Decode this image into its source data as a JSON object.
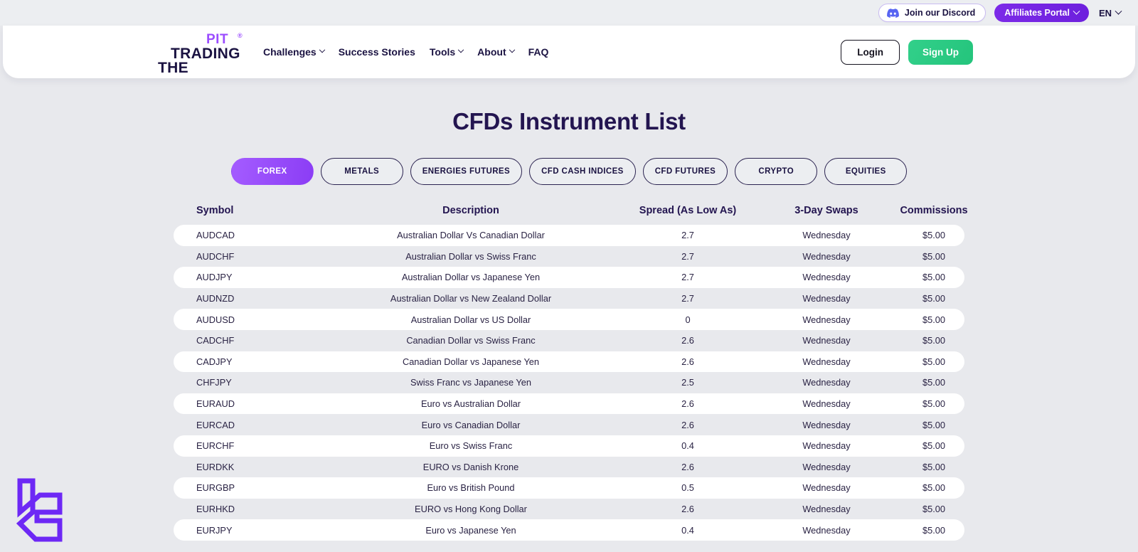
{
  "topbar": {
    "discord_label": "Join our Discord",
    "discord_icon": "discord-icon",
    "affiliates_label": "Affiliates Portal",
    "lang_label": "EN"
  },
  "header": {
    "logo": {
      "the": "THE",
      "trading": "TRADING",
      "pit": "PIT",
      "tm": "®"
    },
    "nav": [
      {
        "label": "Challenges",
        "has_caret": true
      },
      {
        "label": "Success Stories",
        "has_caret": false
      },
      {
        "label": "Tools",
        "has_caret": true
      },
      {
        "label": "About",
        "has_caret": true
      },
      {
        "label": "FAQ",
        "has_caret": false
      }
    ],
    "login_label": "Login",
    "signup_label": "Sign Up"
  },
  "main": {
    "title": "CFDs Instrument List",
    "tabs": [
      {
        "label": "FOREX",
        "active": true
      },
      {
        "label": "METALS",
        "active": false
      },
      {
        "label": "ENERGIES FUTURES",
        "active": false
      },
      {
        "label": "CFD CASH INDICES",
        "active": false
      },
      {
        "label": "CFD FUTURES",
        "active": false
      },
      {
        "label": "CRYPTO",
        "active": false
      },
      {
        "label": "EQUITIES",
        "active": false
      }
    ],
    "table": {
      "columns": [
        "Symbol",
        "Description",
        "Spread (As Low As)",
        "3-Day Swaps",
        "Commissions"
      ],
      "rows": [
        [
          "AUDCAD",
          "Australian Dollar Vs Canadian Dollar",
          "2.7",
          "Wednesday",
          "$5.00"
        ],
        [
          "AUDCHF",
          "Australian Dollar vs Swiss Franc",
          "2.7",
          "Wednesday",
          "$5.00"
        ],
        [
          "AUDJPY",
          "Australian Dollar vs Japanese Yen",
          "2.7",
          "Wednesday",
          "$5.00"
        ],
        [
          "AUDNZD",
          "Australian Dollar vs New Zealand Dollar",
          "2.7",
          "Wednesday",
          "$5.00"
        ],
        [
          "AUDUSD",
          "Australian Dollar vs US Dollar",
          "0",
          "Wednesday",
          "$5.00"
        ],
        [
          "CADCHF",
          "Canadian Dollar vs Swiss Franc",
          "2.6",
          "Wednesday",
          "$5.00"
        ],
        [
          "CADJPY",
          "Canadian Dollar vs Japanese Yen",
          "2.6",
          "Wednesday",
          "$5.00"
        ],
        [
          "CHFJPY",
          "Swiss Franc vs Japanese Yen",
          "2.5",
          "Wednesday",
          "$5.00"
        ],
        [
          "EURAUD",
          "Euro vs Australian Dollar",
          "2.6",
          "Wednesday",
          "$5.00"
        ],
        [
          "EURCAD",
          "Euro vs Canadian Dollar",
          "2.6",
          "Wednesday",
          "$5.00"
        ],
        [
          "EURCHF",
          "Euro vs Swiss Franc",
          "0.4",
          "Wednesday",
          "$5.00"
        ],
        [
          "EURDKK",
          "EURO vs Danish Krone",
          "2.6",
          "Wednesday",
          "$5.00"
        ],
        [
          "EURGBP",
          "Euro vs British Pound",
          "0.5",
          "Wednesday",
          "$5.00"
        ],
        [
          "EURHKD",
          "EURO vs Hong Kong Dollar",
          "2.6",
          "Wednesday",
          "$5.00"
        ],
        [
          "EURJPY",
          "Euro vs Japanese Yen",
          "0.4",
          "Wednesday",
          "$5.00"
        ]
      ]
    }
  },
  "widget": {
    "icon": "chat-widget-logo"
  },
  "colors": {
    "page_bg": "#e8e9ed",
    "purple": "#8b3df5",
    "green": "#24c47c",
    "ink": "#1b1342",
    "title": "#231550"
  }
}
